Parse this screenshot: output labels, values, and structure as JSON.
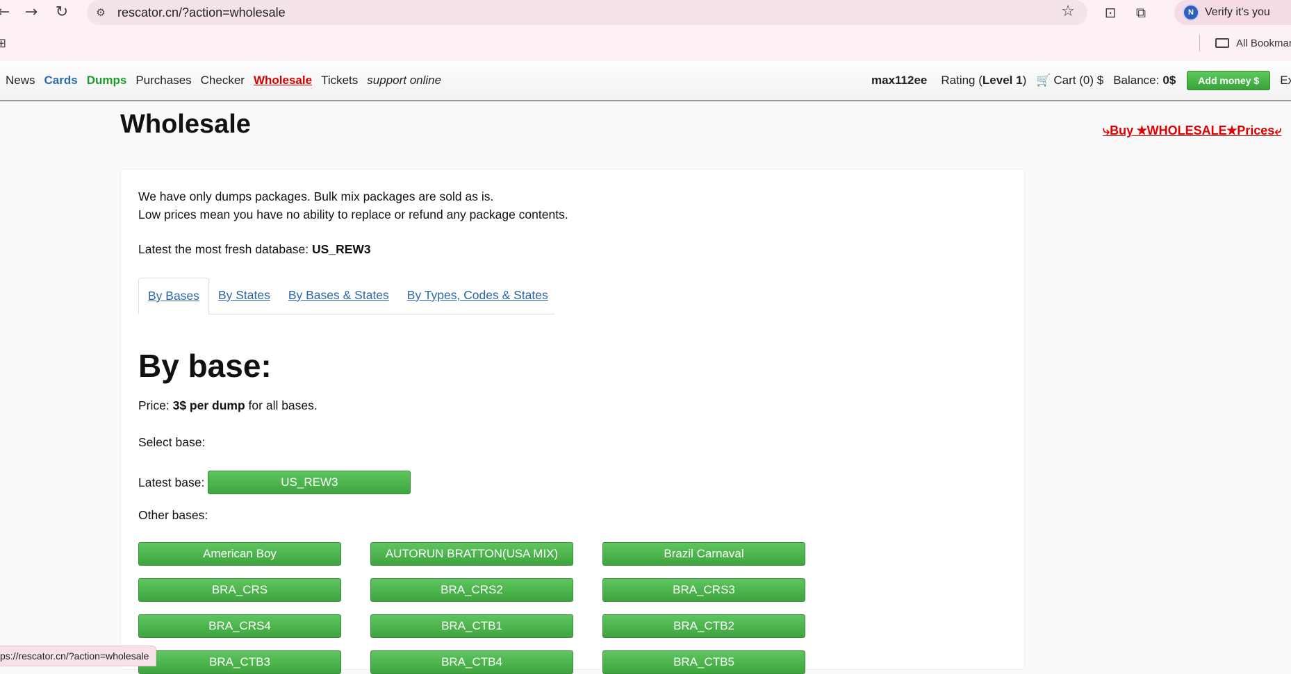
{
  "browser": {
    "back_icon": "arrow-left-icon",
    "forward_icon": "arrow-right-icon",
    "reload_icon": "reload-icon",
    "url": "rescator.cn/?action=wholesale",
    "verify_label": "Verify it's you",
    "profile_initial": "N",
    "bookmarks_label": "All Bookmar"
  },
  "nav": {
    "links": [
      "News",
      "Cards",
      "Dumps",
      "Purchases",
      "Checker",
      "Wholesale",
      "Tickets",
      "support online"
    ],
    "username": "max112ee",
    "rating_prefix": "Rating (",
    "rating_level": "Level 1",
    "rating_suffix": ")",
    "cart": "Cart (0) $",
    "balance_label": "Balance:",
    "balance_value": "0$",
    "add_money": "Add money $",
    "exit": "Exit"
  },
  "page": {
    "title": "Wholesale",
    "buy_link": "⤷Buy ★WHOLESALE★Prices⤶",
    "intro_line1": "We have only dumps packages. Bulk mix packages are sold as is.",
    "intro_line2": "Low prices mean you have no ability to replace or refund any package contents.",
    "latest_db_label": "Latest the most fresh database:",
    "latest_db_value": "US_REW3",
    "tabs": [
      "By Bases",
      "By States",
      "By Bases & States",
      "By Types, Codes & States"
    ],
    "heading": "By base:",
    "price_label": "Price:",
    "price_value": "3$ per dump",
    "price_suffix": "for all bases.",
    "select_base": "Select base:",
    "latest_base_label": "Latest base:",
    "latest_base_button": "US_REW3",
    "other_bases_label": "Other bases:",
    "other_bases": [
      "American Boy",
      "AUTORUN BRATTON(USA MIX)",
      "Brazil Carnaval",
      "BRA_CRS",
      "BRA_CRS2",
      "BRA_CRS3",
      "BRA_CRS4",
      "BRA_CTB1",
      "BRA_CTB2",
      "BRA_CTB3",
      "BRA_CTB4",
      "BRA_CTB5"
    ]
  },
  "status_bar": {
    "url": "ps://rescator.cn/?action=wholesale"
  }
}
